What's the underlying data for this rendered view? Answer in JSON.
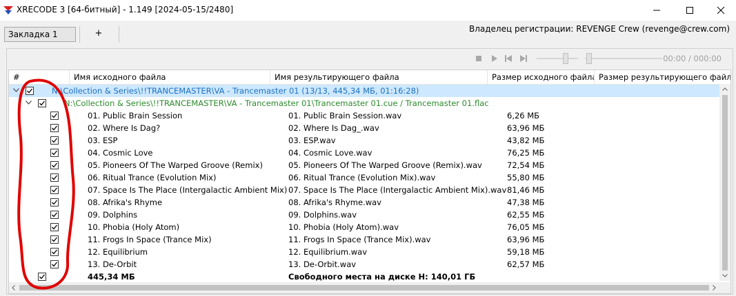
{
  "window": {
    "title": "XRECODE 3 [64-битный] - 1.149 [2024-05-15/2480]"
  },
  "tabs": {
    "active_label": "Закладка 1",
    "add_label": "+"
  },
  "owner_text": "Владелец регистрации: REVENGE Crew (revenge@crew.com)",
  "player": {
    "time": "00:00 / 000:00"
  },
  "columns": [
    "#",
    "Имя исходного файла",
    "Имя результирующего файла",
    "Размер исходного файла",
    "Размер результирующего файла"
  ],
  "group": {
    "label": "N:\\Collection & Series\\!!TRANCEMASTER\\VA - Trancemaster 01 (13/13, 445,34 МБ, 01:16:28)"
  },
  "cue": {
    "label": "N:\\Collection & Series\\!!TRANCEMASTER\\VA - Trancemaster 01\\Trancemaster 01.cue / Trancemaster 01.flac"
  },
  "tracks": [
    {
      "src": "01. Public Brain Session",
      "dst": "01. Public Brain Session.wav",
      "size": "6,26 МБ"
    },
    {
      "src": "02. Where Is Dag?",
      "dst": "02. Where Is Dag_.wav",
      "size": "63,96 МБ"
    },
    {
      "src": "03. ESP",
      "dst": "03. ESP.wav",
      "size": "43,82 МБ"
    },
    {
      "src": "04. Cosmic Love",
      "dst": "04. Cosmic Love.wav",
      "size": "76,25 МБ"
    },
    {
      "src": "05. Pioneers Of The Warped Groove (Remix)",
      "dst": "05. Pioneers Of The Warped Groove (Remix).wav",
      "size": "72,54 МБ"
    },
    {
      "src": "06. Ritual Trance (Evolution Mix)",
      "dst": "06. Ritual Trance (Evolution Mix).wav",
      "size": "55,80 МБ"
    },
    {
      "src": "07. Space Is The Place (Intergalactic Ambient Mix)",
      "dst": "07. Space Is The Place (Intergalactic Ambient Mix).wav",
      "size": "81,46 МБ"
    },
    {
      "src": "08. Afrika's Rhyme",
      "dst": "08. Afrika's Rhyme.wav",
      "size": "47,38 МБ"
    },
    {
      "src": "09. Dolphins",
      "dst": "09. Dolphins.wav",
      "size": "62,55 МБ"
    },
    {
      "src": "10. Phobia (Holy Atom)",
      "dst": "10. Phobia (Holy Atom).wav",
      "size": "76,05 МБ"
    },
    {
      "src": "11. Frogs In Space (Trance Mix)",
      "dst": "11. Frogs In Space (Trance Mix).wav",
      "size": "63,96 МБ"
    },
    {
      "src": "12. Equilibrium",
      "dst": "12. Equilibrium.wav",
      "size": "59,18 МБ"
    },
    {
      "src": "13. De-Orbit",
      "dst": "13. De-Orbit.wav",
      "size": "62,57 МБ"
    }
  ],
  "summary": {
    "total": "445,34 МБ",
    "free_space": "Свободного места на диске H: 140,01 ГБ"
  },
  "colors": {
    "selection": "#cde8ff",
    "group_text": "#1e70c0",
    "cue_text": "#2d8a2d",
    "annotation": "#e00000"
  }
}
